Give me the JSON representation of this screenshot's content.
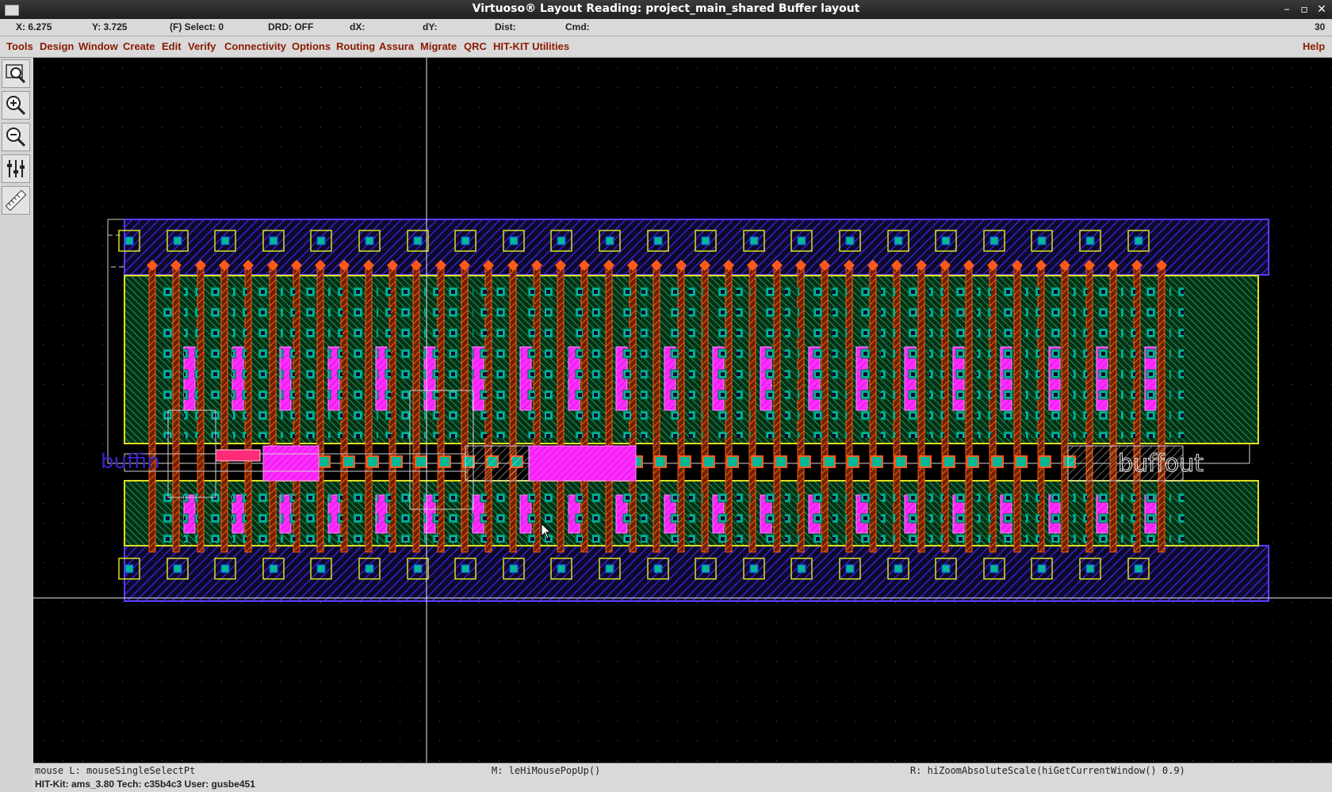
{
  "window": {
    "title": "Virtuoso® Layout Reading: project_main_shared Buffer layout",
    "minimize_glyph": "–",
    "maximize_glyph": "▫",
    "close_glyph": "✕"
  },
  "status": {
    "x": "X:  6.275",
    "y": "Y:  3.725",
    "select": "(F) Select: 0",
    "drd": "DRD: OFF",
    "dx": "dX:",
    "dy": "dY:",
    "dist": "Dist:",
    "cmd": "Cmd:",
    "count": "30"
  },
  "menu": {
    "items": [
      "Tools",
      "Design",
      "Window",
      "Create",
      "Edit",
      "Verify",
      "Connectivity",
      "Options",
      "Routing",
      "Assura",
      "Migrate",
      "QRC",
      "HIT-KIT Utilities"
    ],
    "help": "Help"
  },
  "toolbar": {
    "icons": [
      "zoom-fit-icon",
      "zoom-in-icon",
      "zoom-out-icon",
      "stretch-icon",
      "ruler-icon"
    ]
  },
  "layout": {
    "label_in": "buffin",
    "label_out": "buffout",
    "colors": {
      "metal1": "#3a22c8",
      "poly": "#ff5a1a",
      "diffusion": "#00b896",
      "implant": "#ff2cff",
      "nwell": "#e0e020",
      "crosshair": "#e8e8e8"
    }
  },
  "mouse": {
    "left": "mouse L: mouseSingleSelectPt",
    "middle": "M: leHiMousePopUp()",
    "right": "R: hiZoomAbsoluteScale(hiGetCurrentWindow() 0.9)"
  },
  "info": "HIT-Kit: ams_3.80   Tech: c35b4c3   User: gusbe451"
}
